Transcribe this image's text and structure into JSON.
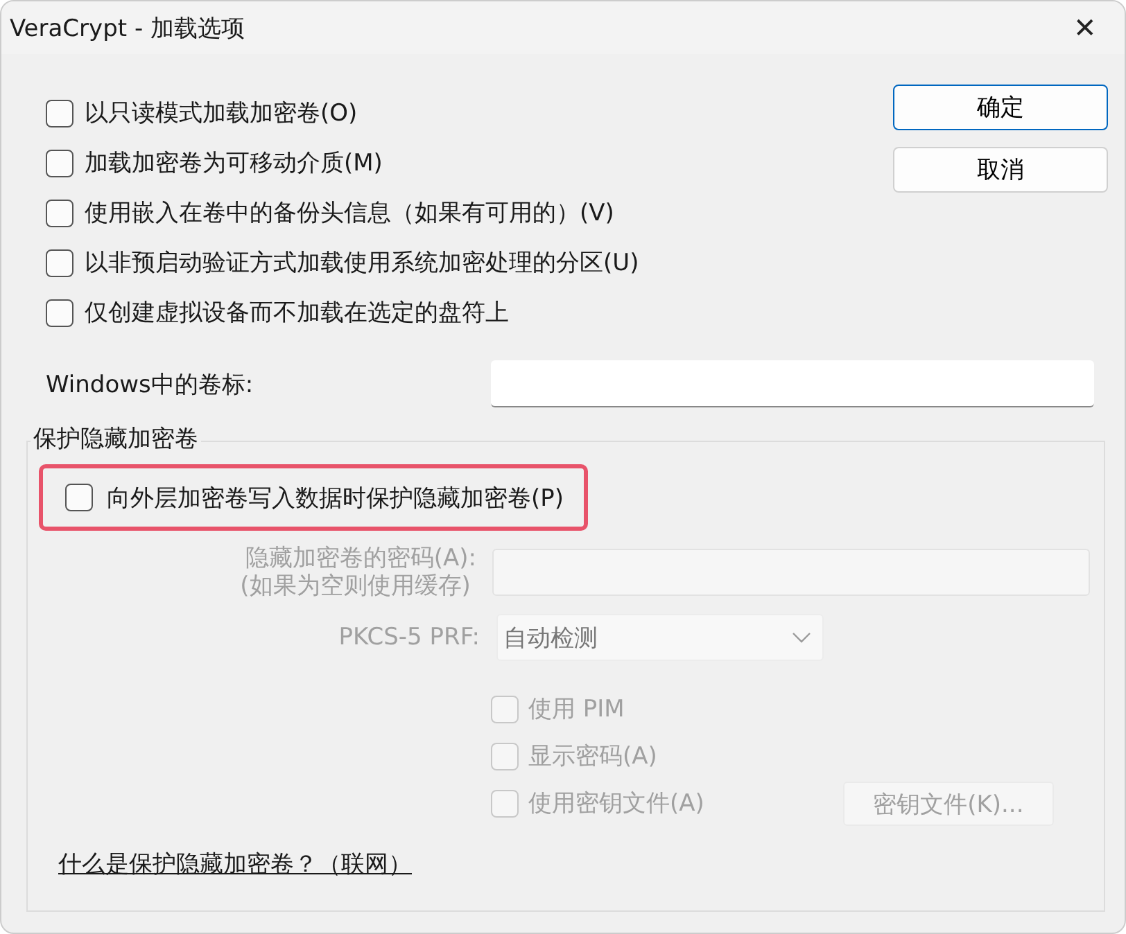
{
  "window": {
    "title": "VeraCrypt - 加载选项",
    "close": "✕"
  },
  "options": [
    {
      "label": "以只读模式加载加密卷(O)",
      "checked": false
    },
    {
      "label": "加载加密卷为可移动介质(M)",
      "checked": false
    },
    {
      "label": "使用嵌入在卷中的备份头信息（如果有可用的）(V)",
      "checked": false
    },
    {
      "label": "以非预启动验证方式加载使用系统加密处理的分区(U)",
      "checked": false
    },
    {
      "label": "仅创建虚拟设备而不加载在选定的盘符上",
      "checked": false
    }
  ],
  "buttons": [
    {
      "label": "确定",
      "default": true
    },
    {
      "label": "取消",
      "default": false
    }
  ],
  "volume_label": {
    "label": "Windows中的卷标:"
  },
  "hidden_group": {
    "title": "保护隐藏加密卷",
    "protect": {
      "label": "向外层加密卷写入数据时保护隐藏加密卷(P)",
      "checked": false,
      "highlighted": true
    },
    "password": {
      "label": "隐藏加密卷的密码(A):",
      "note": "(如果为空则使用缓存)",
      "disabled": true
    },
    "prf": {
      "label": "PKCS-5 PRF:",
      "value": "自动检测",
      "disabled": true
    },
    "checks": [
      {
        "label": "使用 PIM",
        "checked": false,
        "disabled": true
      },
      {
        "label": "显示密码(A)",
        "checked": false,
        "disabled": true
      },
      {
        "label": "使用密钥文件(A)",
        "checked": false,
        "disabled": true
      }
    ],
    "keyfiles_button": {
      "label": "密钥文件(K)...",
      "disabled": true
    },
    "link": "什么是保护隐藏加密卷？（联网）"
  }
}
